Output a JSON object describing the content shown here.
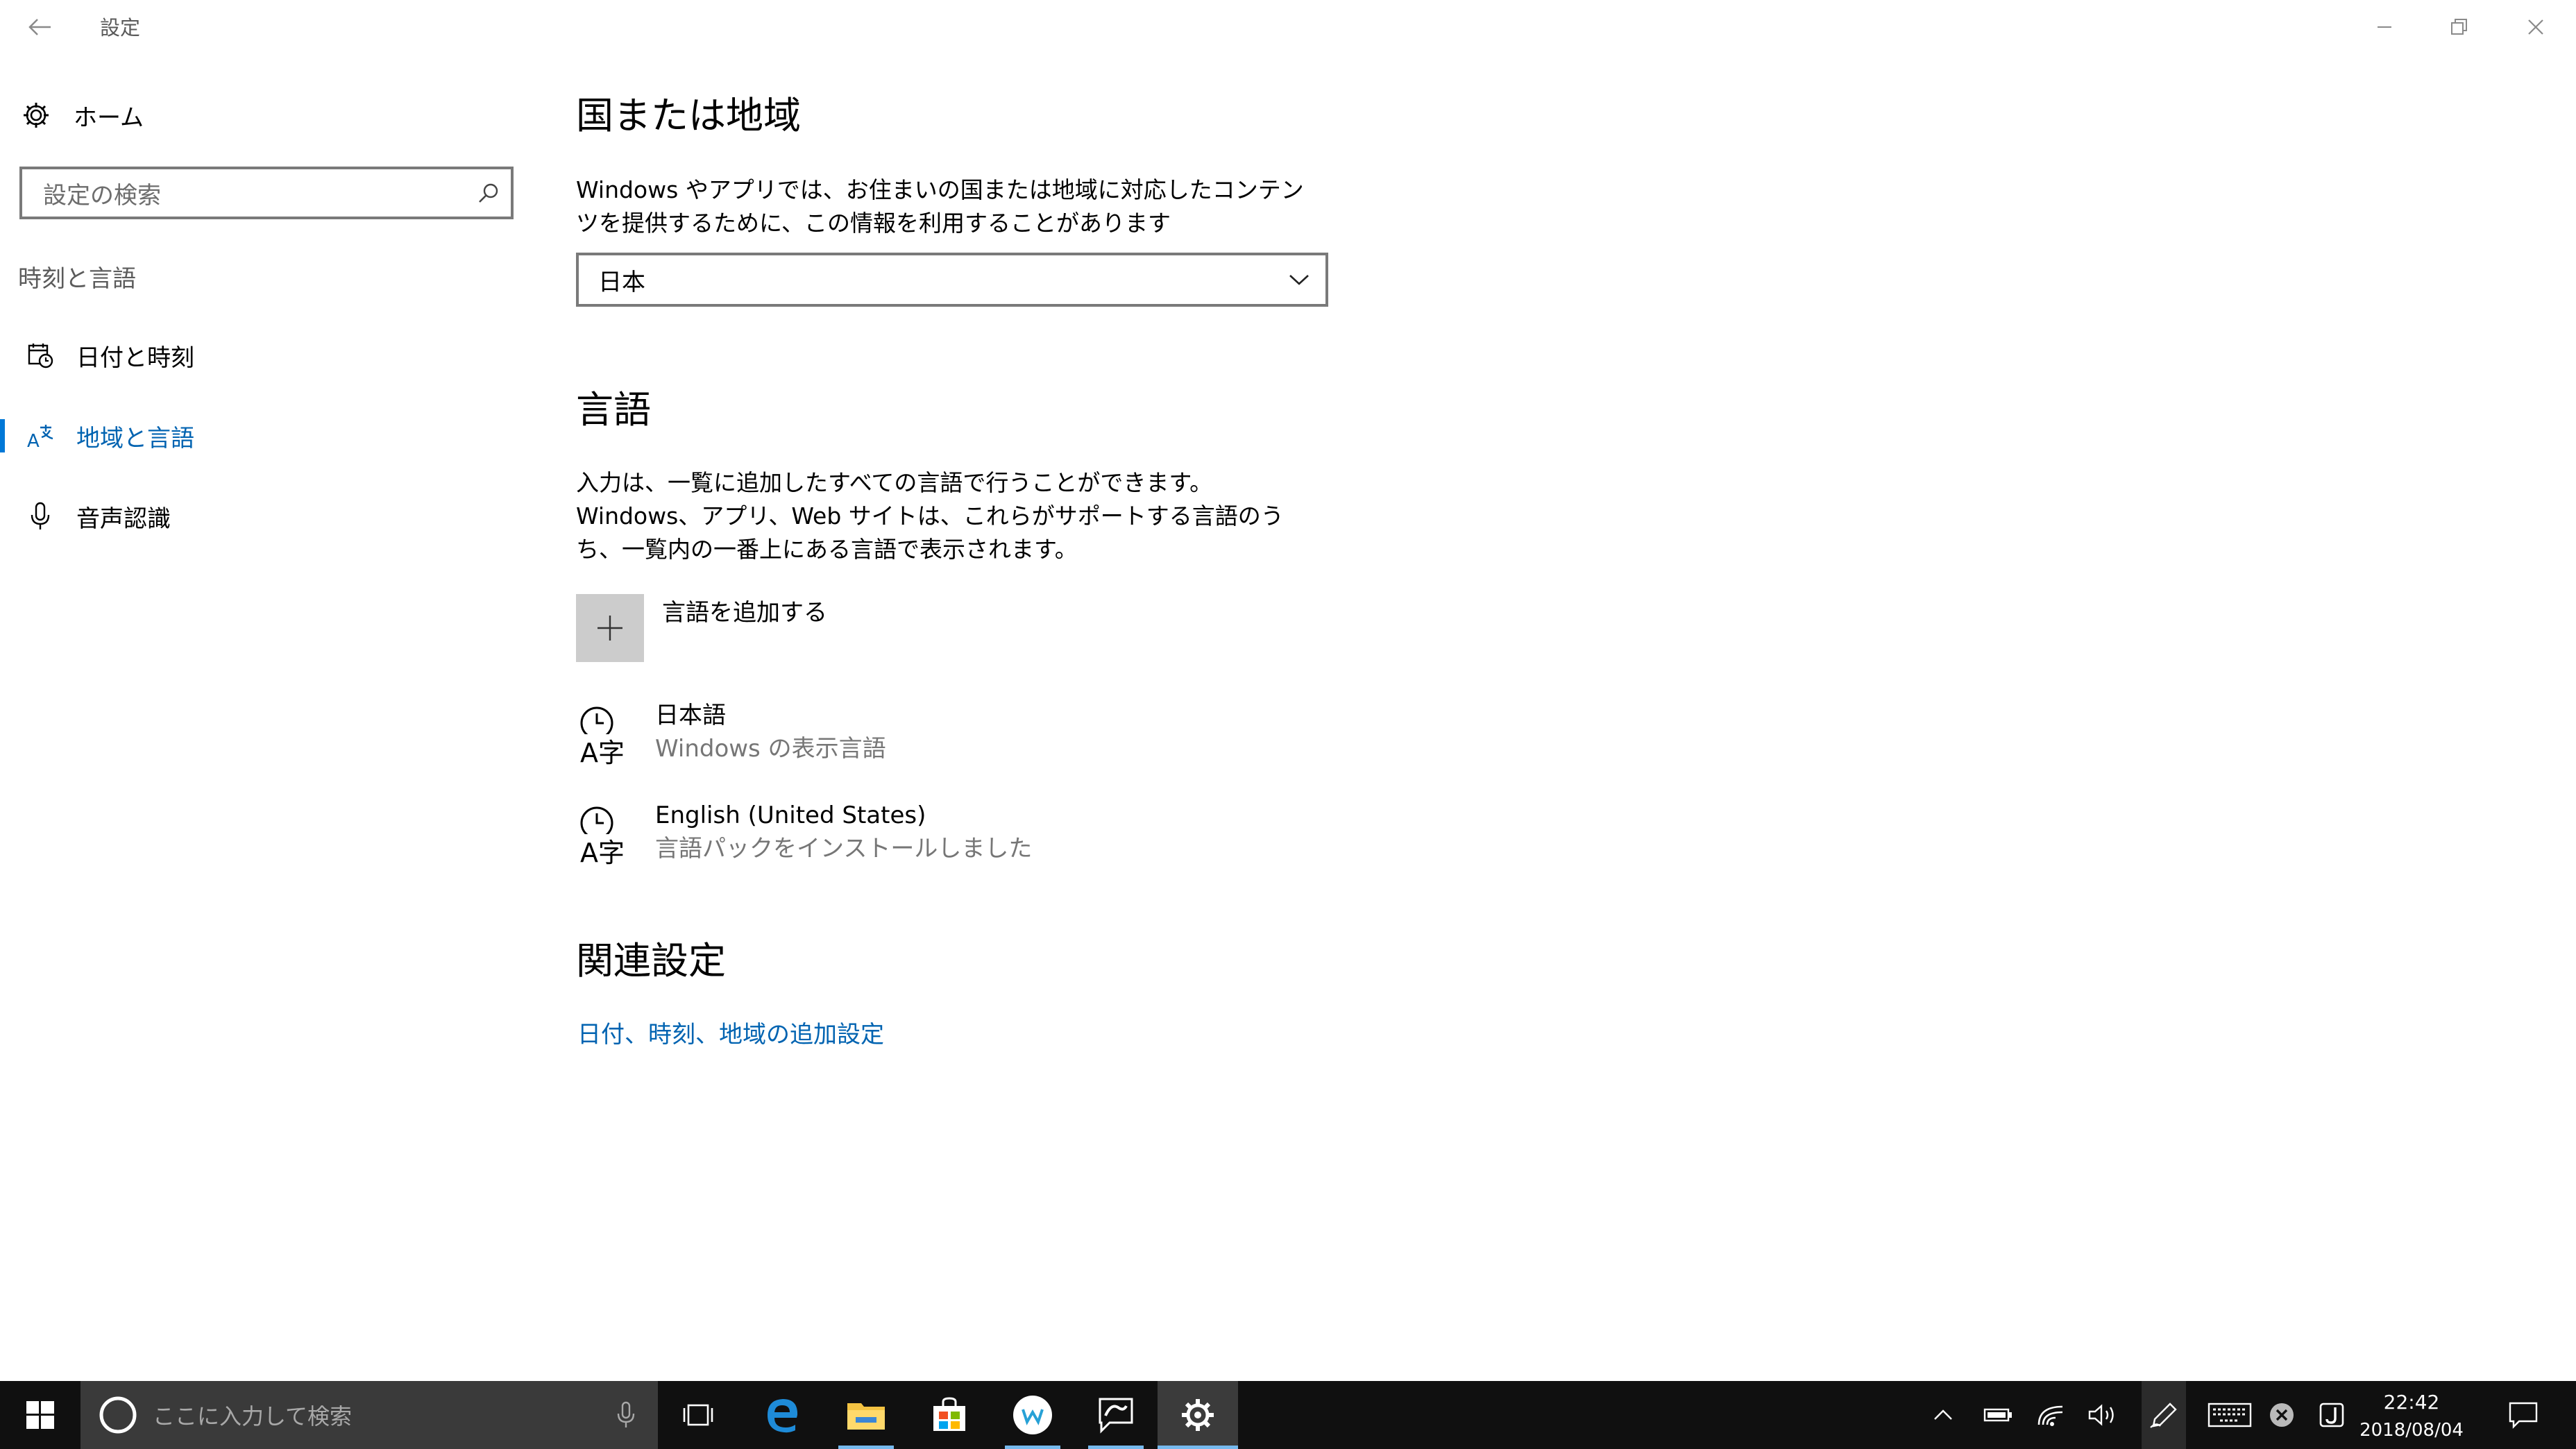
{
  "window": {
    "title": "設定",
    "controls": [
      "minimize-icon",
      "restore-icon",
      "close-icon"
    ]
  },
  "sidebar": {
    "home_label": "ホーム",
    "search_placeholder": "設定の検索",
    "section_title": "時刻と言語",
    "items": [
      {
        "label": "日付と時刻",
        "icon": "calendar-clock-icon",
        "active": false
      },
      {
        "label": "地域と言語",
        "icon": "region-language-icon",
        "active": true
      },
      {
        "label": "音声認識",
        "icon": "microphone-icon",
        "active": false
      }
    ]
  },
  "main": {
    "region": {
      "heading": "国または地域",
      "description": "Windows やアプリでは、お住まいの国または地域に対応したコンテンツを提供するために、この情報を利用することがあります",
      "selected": "日本"
    },
    "language": {
      "heading": "言語",
      "description": "入力は、一覧に追加したすべての言語で行うことができます。Windows、アプリ、Web サイトは、これらがサポートする言語のうち、一覧内の一番上にある言語で表示されます。",
      "add_label": "言語を追加する",
      "languages": [
        {
          "name": "日本語",
          "status": "Windows の表示言語"
        },
        {
          "name": "English (United States)",
          "status": "言語パックをインストールしました"
        }
      ]
    },
    "related": {
      "heading": "関連設定",
      "link": "日付、時刻、地域の追加設定"
    }
  },
  "taskbar": {
    "search_placeholder": "ここに入力して検索",
    "pinned": [
      "task-view-icon",
      "edge-icon",
      "file-explorer-icon",
      "store-icon",
      "wordpad-circle-icon",
      "ink-app-icon",
      "settings-gear-icon"
    ],
    "clock": {
      "time": "22:42",
      "date": "2018/08/04"
    }
  },
  "colors": {
    "accent": "#0078d7",
    "link": "#0063b1",
    "taskbar": "#101010"
  }
}
